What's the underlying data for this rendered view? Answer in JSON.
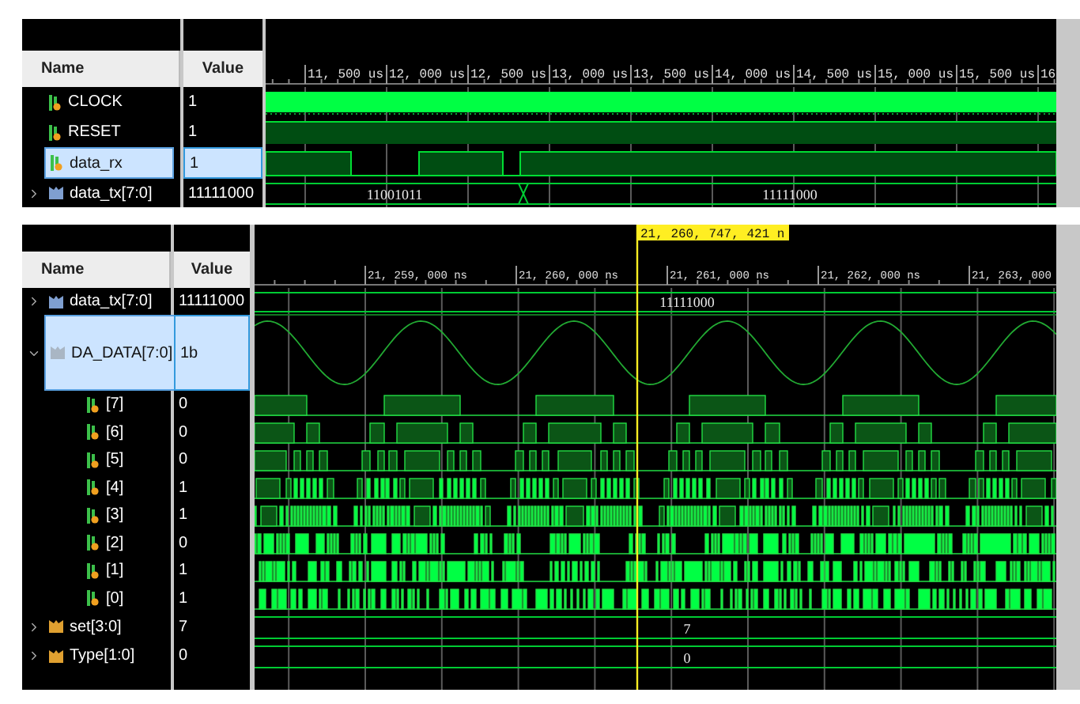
{
  "panels": [
    {
      "columns": {
        "name": "Name",
        "value": "Value"
      },
      "ticks": [
        "11, 500 us",
        "12, 000 us",
        "12, 500 us",
        "13, 000 us",
        "13, 500 us",
        "14, 000 us",
        "14, 500 us",
        "15, 000 us",
        "15, 500 us",
        "16"
      ],
      "signals": [
        {
          "name": "CLOCK",
          "value": "1",
          "kind": "clock",
          "selected": false
        },
        {
          "name": "RESET",
          "value": "1",
          "kind": "constant",
          "selected": false
        },
        {
          "name": "data_rx",
          "value": "1",
          "kind": "serial",
          "selected": true
        },
        {
          "name": "data_tx[7:0]",
          "value": "11111000",
          "kind": "bus",
          "selected": false,
          "expanded": false,
          "color": "#7f9fd0",
          "segments": [
            "11001011",
            "11111000"
          ]
        }
      ]
    },
    {
      "columns": {
        "name": "Name",
        "value": "Value"
      },
      "cursor": {
        "label": "21, 260, 747, 421 n"
      },
      "ticks": [
        "21, 259, 000 ns",
        "21, 260, 000 ns",
        "21, 261, 000 ns",
        "21, 262, 000 ns",
        "21, 263, 000"
      ],
      "signals": [
        {
          "name": "data_tx[7:0]",
          "value": "11111000",
          "kind": "bus",
          "selected": false,
          "expanded": false,
          "color": "#7f9fd0",
          "segments": [
            "11111000"
          ]
        },
        {
          "name": "DA_DATA[7:0]",
          "value": "1b",
          "kind": "analog",
          "selected": true,
          "expanded": true,
          "color": "#a9b6c4",
          "children": [
            {
              "name": "[7]",
              "value": "0",
              "kind": "bit",
              "selected": false
            },
            {
              "name": "[6]",
              "value": "0",
              "kind": "bit",
              "selected": false
            },
            {
              "name": "[5]",
              "value": "0",
              "kind": "bit",
              "selected": false
            },
            {
              "name": "[4]",
              "value": "1",
              "kind": "bit",
              "selected": false
            },
            {
              "name": "[3]",
              "value": "1",
              "kind": "bit",
              "selected": false
            },
            {
              "name": "[2]",
              "value": "0",
              "kind": "bit",
              "selected": false
            },
            {
              "name": "[1]",
              "value": "1",
              "kind": "bit",
              "selected": false
            },
            {
              "name": "[0]",
              "value": "1",
              "kind": "bit",
              "selected": false
            }
          ]
        },
        {
          "name": "set[3:0]",
          "value": "7",
          "kind": "bus",
          "selected": false,
          "expanded": false,
          "color": "#e0a030",
          "segments": [
            "7"
          ]
        },
        {
          "name": "Type[1:0]",
          "value": "0",
          "kind": "bus",
          "selected": false,
          "expanded": false,
          "color": "#e0a030",
          "segments": [
            "0"
          ]
        }
      ]
    }
  ]
}
